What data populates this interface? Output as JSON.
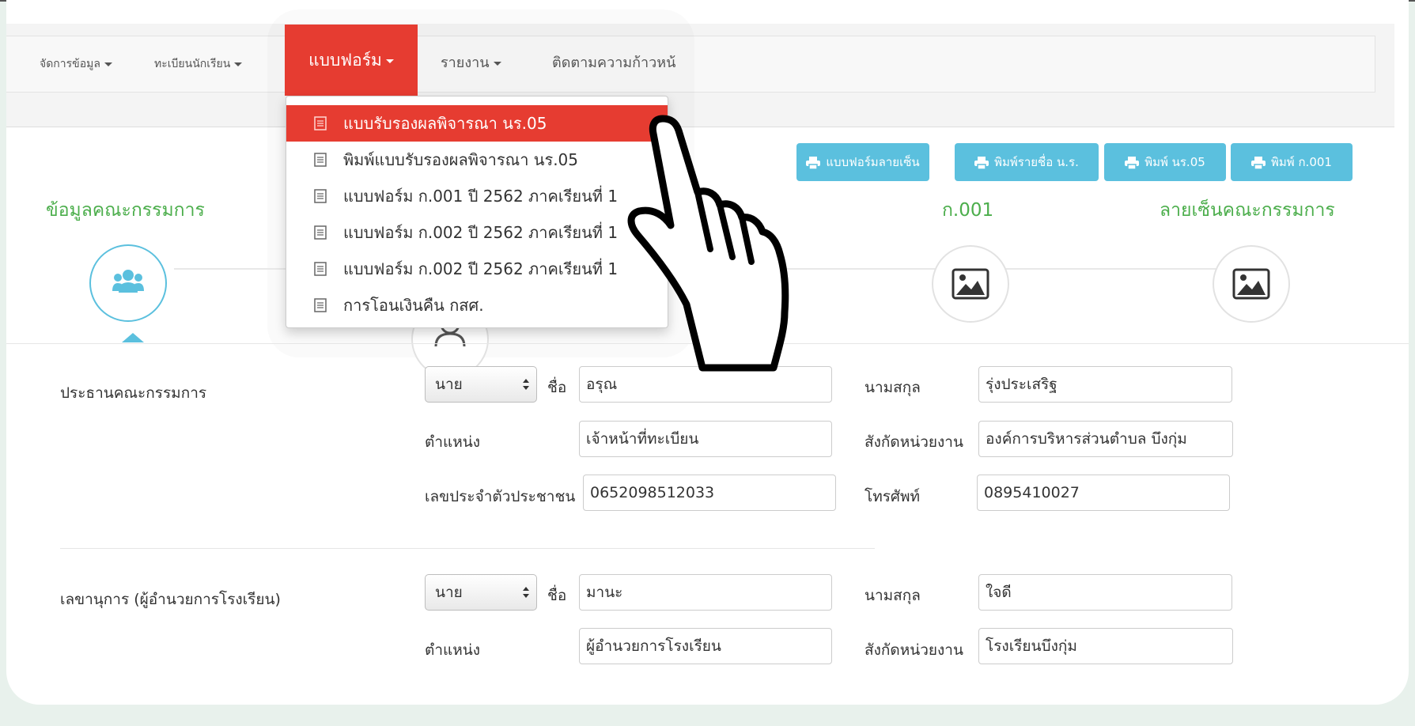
{
  "navbar": {
    "items": [
      {
        "label": "จัดการข้อมูล"
      },
      {
        "label": "ทะเบียนนักเรียน"
      },
      {
        "label": "แบบฟอร์ม"
      },
      {
        "label": "รายงาน"
      },
      {
        "label": "ติดตามความก้าวหน้"
      }
    ]
  },
  "dropdown": {
    "items": [
      {
        "label": "แบบรับรองผลพิจารณา นร.05",
        "active": true
      },
      {
        "label": "พิมพ์แบบรับรองผลพิจารณา นร.05"
      },
      {
        "label": "แบบฟอร์ม ก.001 ปี 2562 ภาคเรียนที่ 1"
      },
      {
        "label": "แบบฟอร์ม ก.002 ปี 2562 ภาคเรียนที่ 1"
      },
      {
        "label": "แบบฟอร์ม ก.002 ปี 2562 ภาคเรียนที่ 1"
      },
      {
        "label": "การโอนเงินคืน กสศ."
      }
    ],
    "icon": "document-list-icon"
  },
  "print_buttons": [
    {
      "label": "แบบฟอร์มลายเซ็น",
      "icon": "printer-icon"
    },
    {
      "label": "พิมพ์รายชื่อ น.ร.",
      "icon": "printer-icon"
    },
    {
      "label": "พิมพ์ นร.05",
      "icon": "printer-icon"
    },
    {
      "label": "พิมพ์ ก.001",
      "icon": "printer-icon"
    }
  ],
  "steps": [
    {
      "title": "ข้อมูลคณะกรรมการ",
      "icon": "users-group-icon"
    },
    {
      "title": "",
      "icon": "user-icon"
    },
    {
      "title": "ก.001",
      "icon": "image-icon"
    },
    {
      "title": "ลายเซ็นคณะกรรมการ",
      "icon": "image-icon"
    }
  ],
  "labels": {
    "first_name": "ชื่อ",
    "last_name": "นามสกุล",
    "position": "ตำแหน่ง",
    "agency": "สังกัดหน่วยงาน",
    "citizen_id": "เลขประจำตัวประชาชน",
    "phone": "โทรศัพท์"
  },
  "chairman": {
    "heading": "ประธานคณะกรรมการ",
    "prefix": "นาย",
    "first_name": "อรุณ",
    "last_name": "รุ่งประเสริฐ",
    "position": "เจ้าหน้าที่ทะเบียน",
    "agency": "องค์การบริหารส่วนตำบล บึงกุ่ม",
    "citizen_id": "0652098512033",
    "phone": "0895410027"
  },
  "secretary": {
    "heading": "เลขานุการ (ผู้อำนวยการโรงเรียน)",
    "prefix": "นาย",
    "first_name": "มานะ",
    "last_name": "ใจดี",
    "position": "ผู้อำนวยการโรงเรียน",
    "agency": "โรงเรียนบึงกุ่ม"
  },
  "colors": {
    "accent_red": "#e63c31",
    "info_blue": "#5bc0de",
    "success_green": "#4cae4c",
    "page_background": "#e8f1ec"
  },
  "overlay": {
    "icon": "pointing-hand-cursor-icon"
  }
}
